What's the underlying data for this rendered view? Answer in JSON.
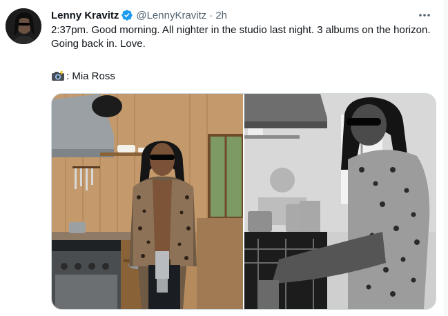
{
  "author": {
    "name": "Lenny Kravitz",
    "handle": "@LennyKravitz",
    "separator": "·",
    "time": "2h",
    "verified_color": "#1d9bf0"
  },
  "tweet": {
    "text": "2:37pm. Good morning. All nighter in the studio last night. 3 albums on the horizon. Going back in. Love.",
    "photo_credit_icon": "camera-with-flash-emoji",
    "photo_credit": ": Mia Ross"
  },
  "menu": {
    "icon": "more-horizontal-icon"
  },
  "media": {
    "count": 2,
    "items": [
      {
        "name": "kitchen-photo-color"
      },
      {
        "name": "kitchen-photo-bw"
      }
    ]
  }
}
